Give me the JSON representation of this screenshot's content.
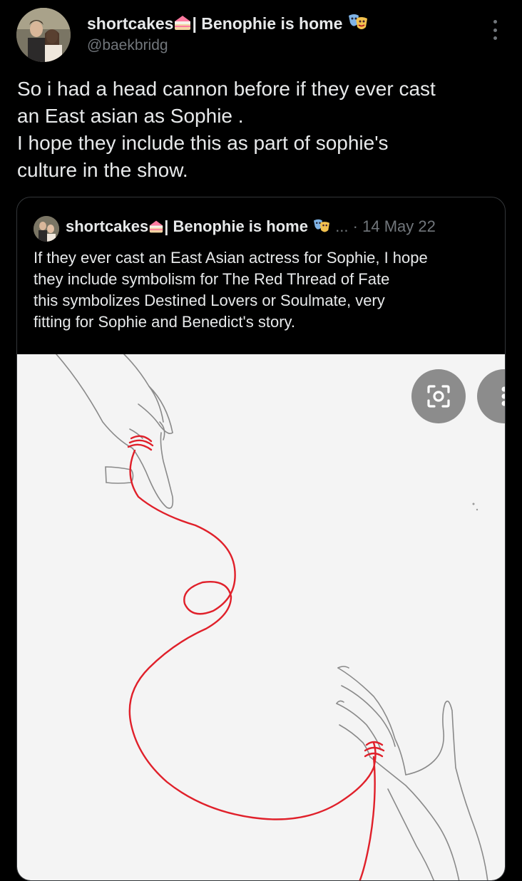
{
  "author": {
    "name": "shortcakes",
    "name_suffix": "| Benophie is home",
    "handle": "@baekbridg"
  },
  "tweet": {
    "lines": [
      "So i had a head cannon before if they ever cast",
      "an East asian as Sophie .",
      "I hope they include this as part of sophie's",
      "culture in the show."
    ]
  },
  "quote": {
    "name": "shortcakes",
    "name_suffix": "| Benophie is home",
    "ellipsis": "...",
    "dot": "·",
    "date": "14 May 22",
    "lines": [
      "If they ever cast an East Asian actress for Sophie, I hope",
      "they include symbolism for The Red Thread of Fate",
      "this symbolizes Destined Lovers or Soulmate, very",
      "fitting for Sophie and Benedict's story."
    ]
  },
  "icons": {
    "cake": "cake-emoji",
    "masks": "theater-masks-emoji",
    "more": "more-vertical-icon",
    "lens": "lens-icon"
  },
  "colors": {
    "background": "#000000",
    "text": "#e7e9ea",
    "muted": "#71767b",
    "thread": "#e0202a"
  }
}
